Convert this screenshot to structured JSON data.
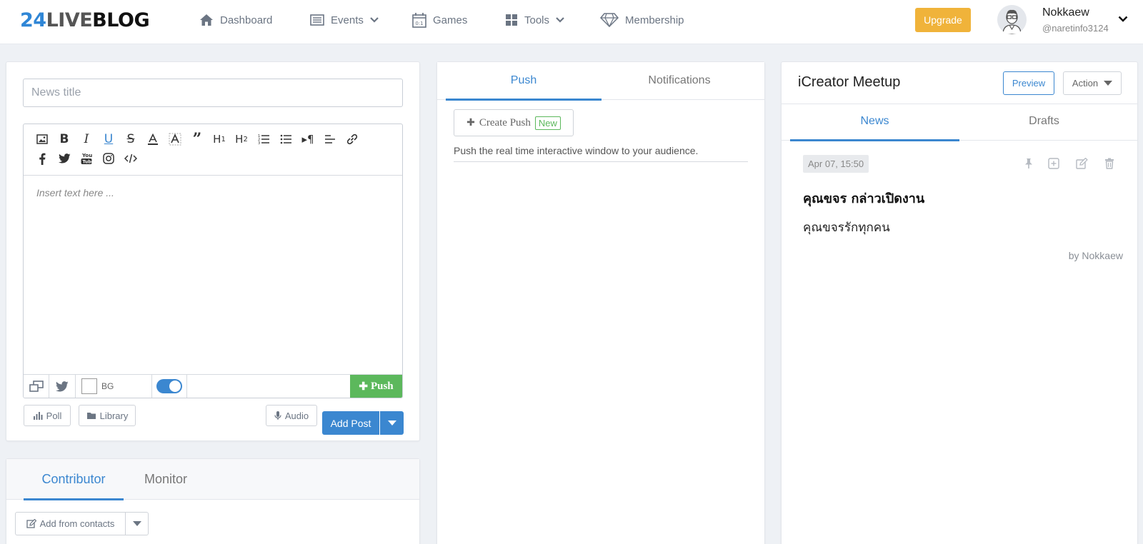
{
  "brand": {
    "num": "24",
    "live": "LIVE",
    "blog": "BLOG"
  },
  "nav": {
    "dashboard": "Dashboard",
    "events": "Events",
    "games": "Games",
    "tools": "Tools",
    "membership": "Membership"
  },
  "header": {
    "upgrade": "Upgrade",
    "user_name": "Nokkaew",
    "user_handle": "@naretinfo3124"
  },
  "editor": {
    "title_placeholder": "News title",
    "body_placeholder": "Insert text here ...",
    "bg_label": "BG",
    "push_label": "Push",
    "poll_label": "Poll",
    "library_label": "Library",
    "audio_label": "Audio",
    "add_post_label": "Add Post"
  },
  "contributor": {
    "tabs": [
      "Contributor",
      "Monitor"
    ],
    "active_tab": "Contributor",
    "add_from_contacts": "Add from contacts"
  },
  "push_panel": {
    "tabs": [
      "Push",
      "Notifications"
    ],
    "active_tab": "Push",
    "create_push": "Create Push",
    "new_badge": "New",
    "description": "Push the real time interactive window to your audience."
  },
  "event_panel": {
    "title": "iCreator Meetup",
    "preview": "Preview",
    "action": "Action",
    "tabs": [
      "News",
      "Drafts"
    ],
    "active_tab": "News",
    "post": {
      "date": "Apr 07, 15:50",
      "title": "คุณขจร กล่าวเปิดงาน",
      "body": "คุณขจรรักทุกคน",
      "by": "by Nokkaew"
    }
  },
  "colors": {
    "accent": "#3b87d0",
    "upgrade": "#f0b33a",
    "push_green": "#5cb85c"
  }
}
